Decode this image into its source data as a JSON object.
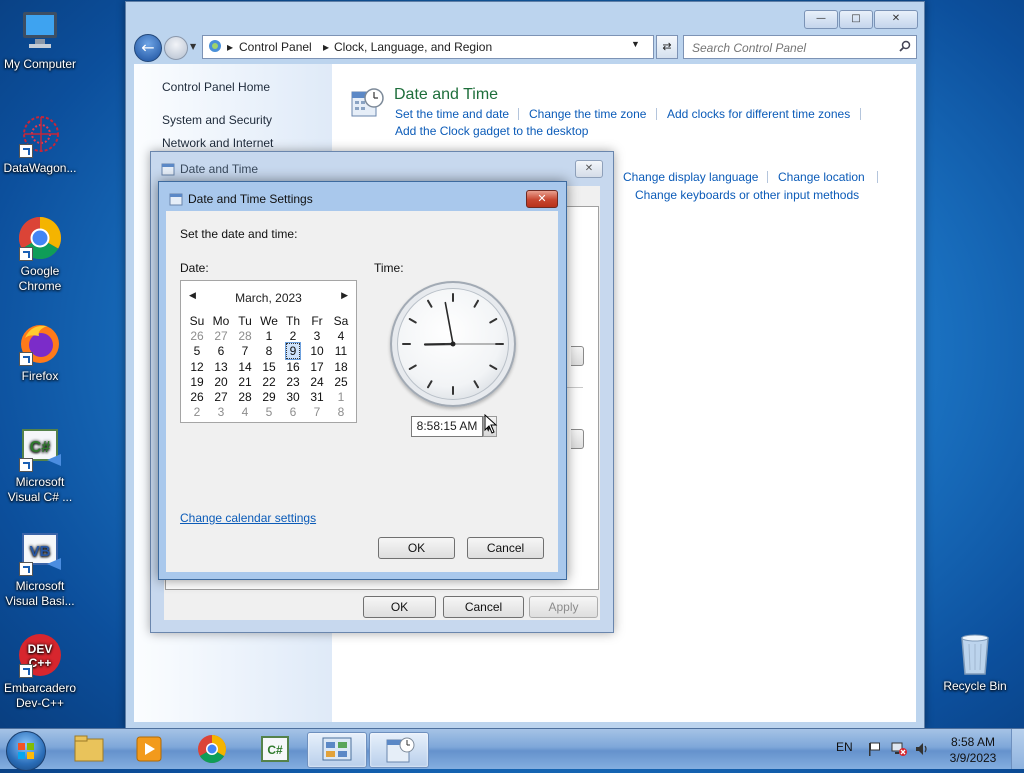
{
  "desktop": {
    "icons": [
      {
        "label": "My Computer"
      },
      {
        "label": "DataWagon..."
      },
      {
        "label": "Google Chrome"
      },
      {
        "label": "Firefox"
      },
      {
        "label": "Microsoft Visual C# ..."
      },
      {
        "label": "Microsoft Visual Basi..."
      },
      {
        "label": "Embarcadero Dev-C++"
      },
      {
        "label": "Recycle Bin"
      }
    ]
  },
  "control_panel": {
    "breadcrumb": [
      "Control Panel",
      "Clock, Language, and Region"
    ],
    "search_placeholder": "Search Control Panel",
    "left_nav": [
      "Control Panel Home",
      "System and Security",
      "Network and Internet"
    ],
    "date_time": {
      "heading": "Date and Time",
      "links": [
        "Set the time and date",
        "Change the time zone",
        "Add clocks for different time zones",
        "Add the Clock gadget to the desktop"
      ]
    },
    "region_links": [
      "Change display language",
      "Change location",
      "Change keyboards or other input methods"
    ]
  },
  "date_time_dialog": {
    "title": "Date and Time",
    "ok": "OK",
    "cancel": "Cancel",
    "apply": "Apply"
  },
  "settings_dialog": {
    "title": "Date and Time Settings",
    "instruction": "Set the date and time:",
    "date_label": "Date:",
    "time_label": "Time:",
    "month_title": "March, 2023",
    "weekdays": [
      "Su",
      "Mo",
      "Tu",
      "We",
      "Th",
      "Fr",
      "Sa"
    ],
    "weeks": [
      [
        {
          "d": "26",
          "dim": true
        },
        {
          "d": "27",
          "dim": true
        },
        {
          "d": "28",
          "dim": true
        },
        {
          "d": "1"
        },
        {
          "d": "2"
        },
        {
          "d": "3"
        },
        {
          "d": "4"
        }
      ],
      [
        {
          "d": "5"
        },
        {
          "d": "6"
        },
        {
          "d": "7"
        },
        {
          "d": "8"
        },
        {
          "d": "9",
          "selected": true
        },
        {
          "d": "10"
        },
        {
          "d": "11"
        }
      ],
      [
        {
          "d": "12"
        },
        {
          "d": "13"
        },
        {
          "d": "14"
        },
        {
          "d": "15"
        },
        {
          "d": "16"
        },
        {
          "d": "17"
        },
        {
          "d": "18"
        }
      ],
      [
        {
          "d": "19"
        },
        {
          "d": "20"
        },
        {
          "d": "21"
        },
        {
          "d": "22"
        },
        {
          "d": "23"
        },
        {
          "d": "24"
        },
        {
          "d": "25"
        }
      ],
      [
        {
          "d": "26"
        },
        {
          "d": "27"
        },
        {
          "d": "28"
        },
        {
          "d": "29"
        },
        {
          "d": "30"
        },
        {
          "d": "31"
        },
        {
          "d": "1",
          "dim": true
        }
      ],
      [
        {
          "d": "2",
          "dim": true
        },
        {
          "d": "3",
          "dim": true
        },
        {
          "d": "4",
          "dim": true
        },
        {
          "d": "5",
          "dim": true
        },
        {
          "d": "6",
          "dim": true
        },
        {
          "d": "7",
          "dim": true
        },
        {
          "d": "8",
          "dim": true
        }
      ]
    ],
    "time_value": "8:58:15 AM",
    "clock": {
      "hours": 8,
      "minutes": 58,
      "seconds": 15
    },
    "calendar_link": "Change calendar settings",
    "ok": "OK",
    "cancel": "Cancel"
  },
  "taskbar": {
    "language": "EN",
    "time": "8:58 AM",
    "date": "3/9/2023"
  },
  "colors": {
    "link": "#0b5bb8",
    "heading_green": "#1e6e3b",
    "close_red": "#c74630"
  }
}
